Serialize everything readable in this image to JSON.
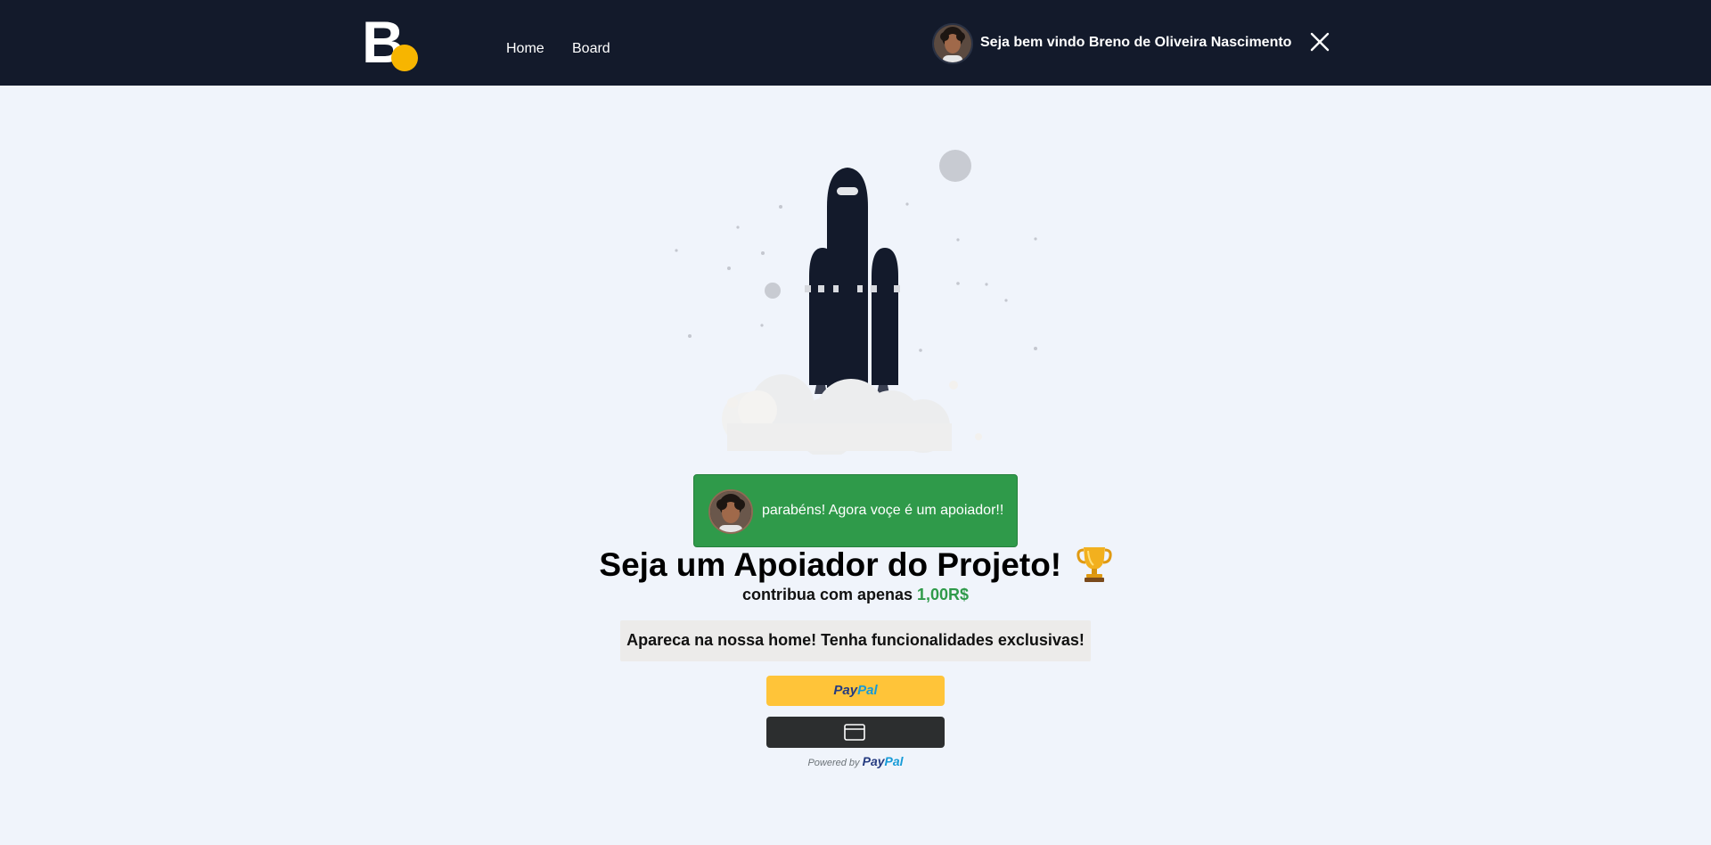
{
  "header": {
    "logo_letter": "B",
    "nav": [
      {
        "label": "Home"
      },
      {
        "label": "Board"
      }
    ],
    "welcome_text": "Seja bem vindo Breno de Oliveira Nascimento",
    "close_icon": "close-icon"
  },
  "toast": {
    "message": "parabéns! Agora voçe é um apoiador!!"
  },
  "main": {
    "title": "Seja um Apoiador do Projeto!",
    "title_icon": "trophy-icon",
    "subtitle_prefix": "contribua com apenas",
    "price": "1,00R$",
    "benefits": "Apareca na nossa home! Tenha funcionalidades exclusivas!"
  },
  "payment": {
    "paypal_label_part1": "Pay",
    "paypal_label_part2": "Pal",
    "card_button_icon": "card-icon",
    "powered_by_label": "Powered by",
    "powered_by_brand_part1": "Pay",
    "powered_by_brand_part2": "Pal"
  },
  "colors": {
    "header_bg": "#131a2b",
    "page_bg": "#f0f4fb",
    "logo_accent": "#f7b500",
    "success": "#2f9a4a",
    "paypal_yellow": "#ffc439",
    "card_button_bg": "#2c2e2f"
  }
}
